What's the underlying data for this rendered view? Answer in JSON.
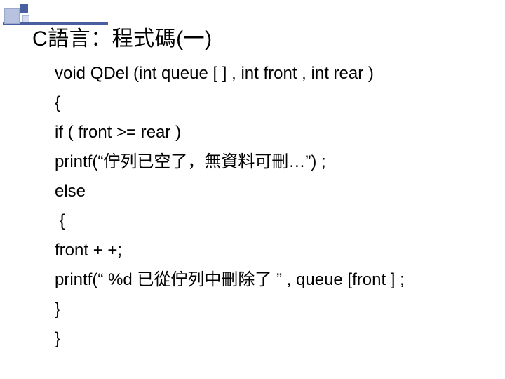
{
  "title": "C語言：程式碼(一)",
  "code": {
    "l1": "void QDel (int queue [ ] , int front , int rear )",
    "l2": "{",
    "l3": "if ( front >= rear )",
    "l4": "printf(“佇列已空了，無資料可刪…”) ;",
    "l5": "else",
    "l6": " {",
    "l7": "front + +;",
    "l8": "printf(“ %d 已從佇列中刪除了 ” , queue [front ] ;",
    "l9": "}",
    "l10": "}"
  }
}
